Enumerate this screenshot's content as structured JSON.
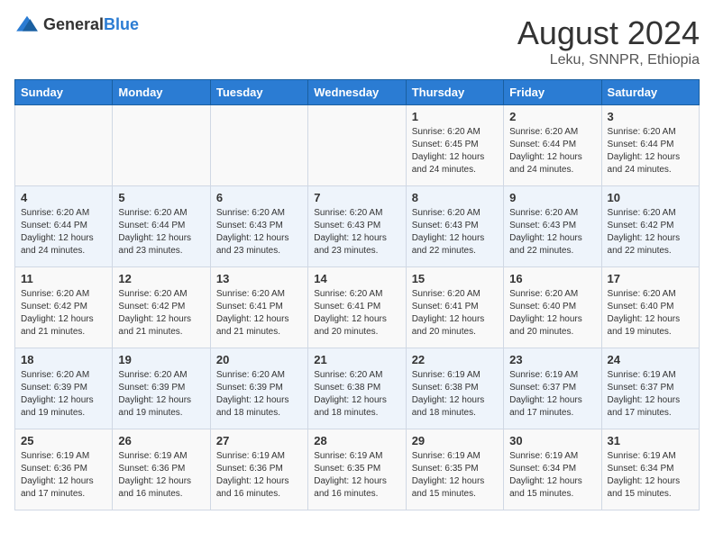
{
  "header": {
    "logo_general": "General",
    "logo_blue": "Blue",
    "month_title": "August 2024",
    "location": "Leku, SNNPR, Ethiopia"
  },
  "days_of_week": [
    "Sunday",
    "Monday",
    "Tuesday",
    "Wednesday",
    "Thursday",
    "Friday",
    "Saturday"
  ],
  "weeks": [
    [
      {
        "day": "",
        "info": ""
      },
      {
        "day": "",
        "info": ""
      },
      {
        "day": "",
        "info": ""
      },
      {
        "day": "",
        "info": ""
      },
      {
        "day": "1",
        "info": "Sunrise: 6:20 AM\nSunset: 6:45 PM\nDaylight: 12 hours\nand 24 minutes."
      },
      {
        "day": "2",
        "info": "Sunrise: 6:20 AM\nSunset: 6:44 PM\nDaylight: 12 hours\nand 24 minutes."
      },
      {
        "day": "3",
        "info": "Sunrise: 6:20 AM\nSunset: 6:44 PM\nDaylight: 12 hours\nand 24 minutes."
      }
    ],
    [
      {
        "day": "4",
        "info": "Sunrise: 6:20 AM\nSunset: 6:44 PM\nDaylight: 12 hours\nand 24 minutes."
      },
      {
        "day": "5",
        "info": "Sunrise: 6:20 AM\nSunset: 6:44 PM\nDaylight: 12 hours\nand 23 minutes."
      },
      {
        "day": "6",
        "info": "Sunrise: 6:20 AM\nSunset: 6:43 PM\nDaylight: 12 hours\nand 23 minutes."
      },
      {
        "day": "7",
        "info": "Sunrise: 6:20 AM\nSunset: 6:43 PM\nDaylight: 12 hours\nand 23 minutes."
      },
      {
        "day": "8",
        "info": "Sunrise: 6:20 AM\nSunset: 6:43 PM\nDaylight: 12 hours\nand 22 minutes."
      },
      {
        "day": "9",
        "info": "Sunrise: 6:20 AM\nSunset: 6:43 PM\nDaylight: 12 hours\nand 22 minutes."
      },
      {
        "day": "10",
        "info": "Sunrise: 6:20 AM\nSunset: 6:42 PM\nDaylight: 12 hours\nand 22 minutes."
      }
    ],
    [
      {
        "day": "11",
        "info": "Sunrise: 6:20 AM\nSunset: 6:42 PM\nDaylight: 12 hours\nand 21 minutes."
      },
      {
        "day": "12",
        "info": "Sunrise: 6:20 AM\nSunset: 6:42 PM\nDaylight: 12 hours\nand 21 minutes."
      },
      {
        "day": "13",
        "info": "Sunrise: 6:20 AM\nSunset: 6:41 PM\nDaylight: 12 hours\nand 21 minutes."
      },
      {
        "day": "14",
        "info": "Sunrise: 6:20 AM\nSunset: 6:41 PM\nDaylight: 12 hours\nand 20 minutes."
      },
      {
        "day": "15",
        "info": "Sunrise: 6:20 AM\nSunset: 6:41 PM\nDaylight: 12 hours\nand 20 minutes."
      },
      {
        "day": "16",
        "info": "Sunrise: 6:20 AM\nSunset: 6:40 PM\nDaylight: 12 hours\nand 20 minutes."
      },
      {
        "day": "17",
        "info": "Sunrise: 6:20 AM\nSunset: 6:40 PM\nDaylight: 12 hours\nand 19 minutes."
      }
    ],
    [
      {
        "day": "18",
        "info": "Sunrise: 6:20 AM\nSunset: 6:39 PM\nDaylight: 12 hours\nand 19 minutes."
      },
      {
        "day": "19",
        "info": "Sunrise: 6:20 AM\nSunset: 6:39 PM\nDaylight: 12 hours\nand 19 minutes."
      },
      {
        "day": "20",
        "info": "Sunrise: 6:20 AM\nSunset: 6:39 PM\nDaylight: 12 hours\nand 18 minutes."
      },
      {
        "day": "21",
        "info": "Sunrise: 6:20 AM\nSunset: 6:38 PM\nDaylight: 12 hours\nand 18 minutes."
      },
      {
        "day": "22",
        "info": "Sunrise: 6:19 AM\nSunset: 6:38 PM\nDaylight: 12 hours\nand 18 minutes."
      },
      {
        "day": "23",
        "info": "Sunrise: 6:19 AM\nSunset: 6:37 PM\nDaylight: 12 hours\nand 17 minutes."
      },
      {
        "day": "24",
        "info": "Sunrise: 6:19 AM\nSunset: 6:37 PM\nDaylight: 12 hours\nand 17 minutes."
      }
    ],
    [
      {
        "day": "25",
        "info": "Sunrise: 6:19 AM\nSunset: 6:36 PM\nDaylight: 12 hours\nand 17 minutes."
      },
      {
        "day": "26",
        "info": "Sunrise: 6:19 AM\nSunset: 6:36 PM\nDaylight: 12 hours\nand 16 minutes."
      },
      {
        "day": "27",
        "info": "Sunrise: 6:19 AM\nSunset: 6:36 PM\nDaylight: 12 hours\nand 16 minutes."
      },
      {
        "day": "28",
        "info": "Sunrise: 6:19 AM\nSunset: 6:35 PM\nDaylight: 12 hours\nand 16 minutes."
      },
      {
        "day": "29",
        "info": "Sunrise: 6:19 AM\nSunset: 6:35 PM\nDaylight: 12 hours\nand 15 minutes."
      },
      {
        "day": "30",
        "info": "Sunrise: 6:19 AM\nSunset: 6:34 PM\nDaylight: 12 hours\nand 15 minutes."
      },
      {
        "day": "31",
        "info": "Sunrise: 6:19 AM\nSunset: 6:34 PM\nDaylight: 12 hours\nand 15 minutes."
      }
    ]
  ]
}
